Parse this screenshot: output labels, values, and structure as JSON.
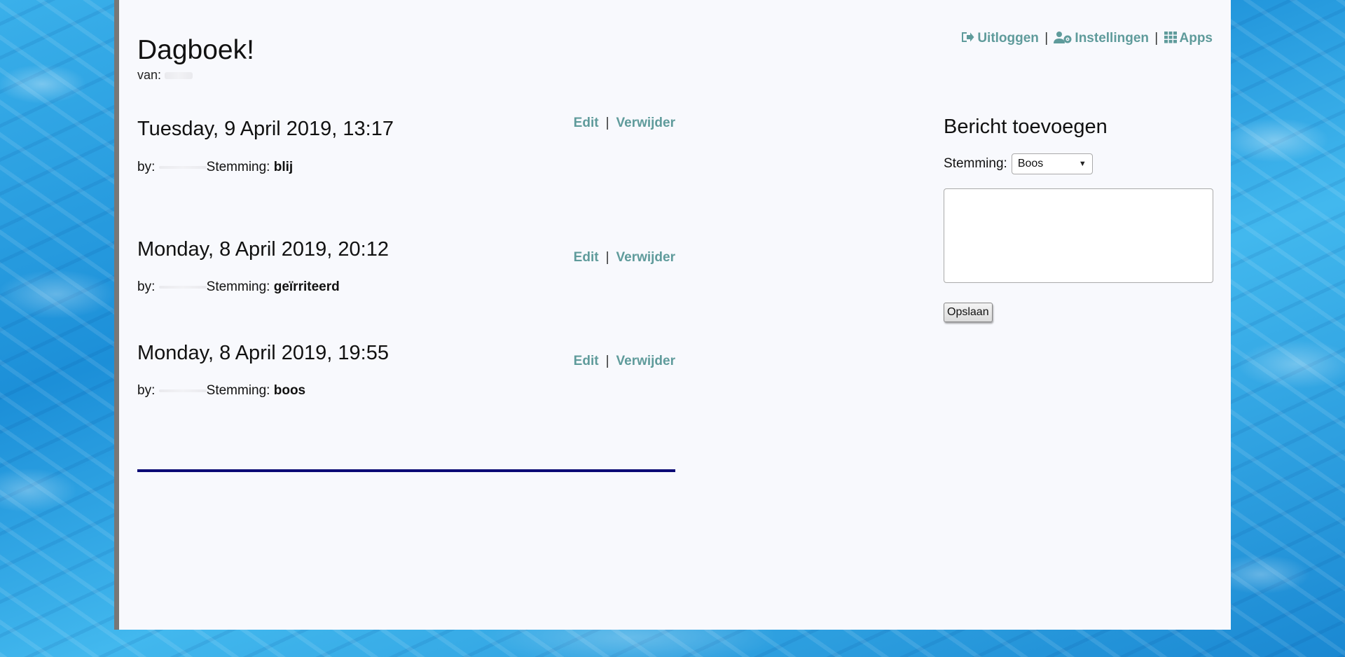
{
  "header": {
    "title": "Dagboek!",
    "author_label": "van:"
  },
  "nav": {
    "logout": "Uitloggen",
    "settings": "Instellingen",
    "apps": "Apps",
    "separator": "|"
  },
  "entries": [
    {
      "date": "Tuesday, 9 April 2019, 13:17",
      "by_label": "by:",
      "mood_label": "Stemming:",
      "mood": "blij",
      "edit": "Edit",
      "delete": "Verwijder"
    },
    {
      "date": "Monday, 8 April 2019, 20:12",
      "by_label": "by:",
      "mood_label": "Stemming:",
      "mood": "geïrriteerd",
      "edit": "Edit",
      "delete": "Verwijder"
    },
    {
      "date": "Monday, 8 April 2019, 19:55",
      "by_label": "by:",
      "mood_label": "Stemming:",
      "mood": "boos",
      "edit": "Edit",
      "delete": "Verwijder"
    }
  ],
  "sidebar": {
    "title": "Bericht toevoegen",
    "mood_label": "Stemming:",
    "mood_selected": "Boos",
    "save_label": "Opslaan"
  },
  "colors": {
    "link": "#5f9b9b",
    "divider": "#0b0a75",
    "page_bg": "#f8f9fd"
  }
}
